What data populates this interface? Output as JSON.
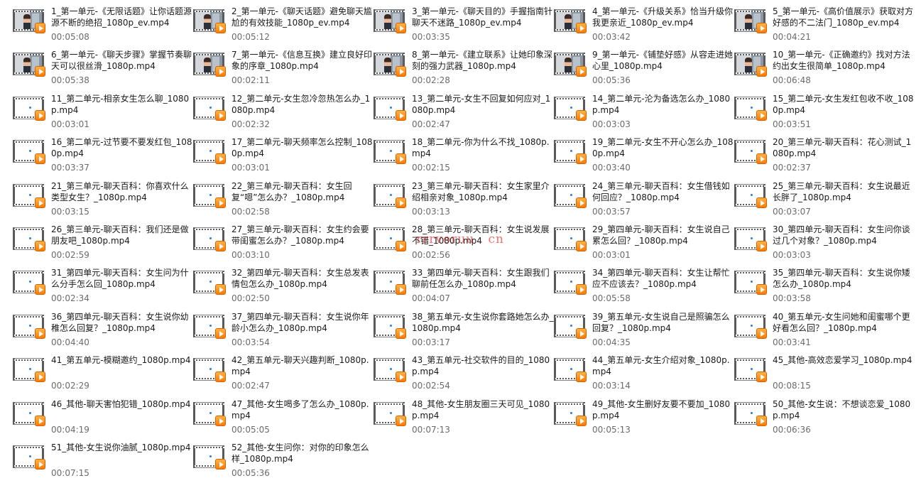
{
  "watermark": "rrrvoruu . cn",
  "files": [
    {
      "name": "1_第一单元-《无限话题》让你话题源源不断的绝招_1080p_ev.mp4",
      "duration": "00:05:08",
      "thumb": "photo"
    },
    {
      "name": "2_第一单元-《聊天话题》避免聊天尴尬的有效技能_1080p_ev.mp4",
      "duration": "00:05:12",
      "thumb": "photo"
    },
    {
      "name": "3_第一单元-《聊天目的》手握指南针聊天不迷路_1080p_ev.mp4",
      "duration": "00:03:35",
      "thumb": "photo"
    },
    {
      "name": "4_第一单元-《升级关系》恰当升级你我更亲近_1080p_ev.mp4",
      "duration": "00:03:42",
      "thumb": "photo"
    },
    {
      "name": "5_第一单元-《高价值展示》获取对方好感的不二法门_1080p_ev.mp4",
      "duration": "00:04:21",
      "thumb": "photo"
    },
    {
      "name": "6_第一单元-《聊天步骤》掌握节奏聊天可以很丝滑_1080p.mp4",
      "duration": "00:05:38",
      "thumb": "photo"
    },
    {
      "name": "7_第一单元-《信息互换》建立良好印象的序章_1080p.mp4",
      "duration": "00:02:11",
      "thumb": "photo"
    },
    {
      "name": "8_第一单元-《建立联系》让她印象深刻的强力武器_1080p.mp4",
      "duration": "00:02:28",
      "thumb": "photo"
    },
    {
      "name": "9_第一单元-《铺垫好感》从容走进她心里_1080p.mp4",
      "duration": "00:05:36",
      "thumb": "photo"
    },
    {
      "name": "10_第一单元-《正确邀约》找对方法约出女生很简单_1080p.mp4",
      "duration": "00:06:48",
      "thumb": "photo"
    },
    {
      "name": "11_第二单元-相亲女生怎么聊_1080p.mp4",
      "duration": "00:03:01",
      "thumb": "blank"
    },
    {
      "name": "12_第二单元-女生忽冷忽热怎么办_1080p.mp4",
      "duration": "00:02:32",
      "thumb": "blank"
    },
    {
      "name": "13_第二单元-女生不回复如何应对_1080p.mp4",
      "duration": "00:02:47",
      "thumb": "blank"
    },
    {
      "name": "14_第二单元-沦为备选怎么办_1080p.mp4",
      "duration": "00:03:03",
      "thumb": "blank"
    },
    {
      "name": "15_第二单元-女生发红包收不收_1080p.mp4",
      "duration": "00:03:51",
      "thumb": "blank"
    },
    {
      "name": "16_第二单元-过节要不要发红包_1080p.mp4",
      "duration": "00:03:37",
      "thumb": "blank"
    },
    {
      "name": "17_第二单元-聊天频率怎么控制_1080p.mp4",
      "duration": "00:03:01",
      "thumb": "blank"
    },
    {
      "name": "18_第二单元-你为什么不找_1080p.mp4",
      "duration": "00:02:15",
      "thumb": "blank"
    },
    {
      "name": "19_第二单元-女生不开心怎么办_1080p.mp4",
      "duration": "00:03:40",
      "thumb": "blank"
    },
    {
      "name": "20_第三单元-聊天百科：花心测试_1080p.mp4",
      "duration": "00:02:37",
      "thumb": "blank"
    },
    {
      "name": "21_第三单元-聊天百科：你喜欢什么类型女生？_1080p.mp4",
      "duration": "00:03:15",
      "thumb": "blank"
    },
    {
      "name": "22_第三单元-聊天百科：女生回复“嗯”怎么办？_1080p.mp4",
      "duration": "00:02:58",
      "thumb": "blank"
    },
    {
      "name": "23_第三单元-聊天百科：女生家里介绍相亲对象_1080p.mp4",
      "duration": "00:03:13",
      "thumb": "blank"
    },
    {
      "name": "24_第三单元-聊天百科：女生借钱如何回应？_1080p.mp4",
      "duration": "00:03:57",
      "thumb": "blank"
    },
    {
      "name": "25_第三单元-聊天百科：女生说最近长胖了_1080p.mp4",
      "duration": "00:03:07",
      "thumb": "blank"
    },
    {
      "name": "26_第三单元-聊天百科：我们还是做朋友吧_1080p.mp4",
      "duration": "00:02:59",
      "thumb": "blank"
    },
    {
      "name": "27_第三单元-聊天百科：女生约会要带闺蜜怎么办？_1080p.mp4",
      "duration": "00:03:10",
      "thumb": "blank"
    },
    {
      "name": "28_第三单元-聊天百科：女生说发展不错_1080p.mp4",
      "duration": "00:02:56",
      "thumb": "blank"
    },
    {
      "name": "29_第四单元-聊天百科：女生说自己累怎么回？_1080p.mp4",
      "duration": "00:03:01",
      "thumb": "blank"
    },
    {
      "name": "30_第四单元-聊天百科：女生问你谈过几个对象？_1080p.mp4",
      "duration": "00:03:03",
      "thumb": "blank"
    },
    {
      "name": "31_第四单元-聊天百科：女生问为什么分手怎么回_1080p.mp4",
      "duration": "00:02:34",
      "thumb": "blank"
    },
    {
      "name": "32_第四单元-聊天百科：女生总发表情包怎么办_1080p.mp4",
      "duration": "00:02:50",
      "thumb": "blank"
    },
    {
      "name": "33_第四单元-聊天百科：女生跟我们聊前任怎么办_1080p.mp4",
      "duration": "00:04:07",
      "thumb": "blank"
    },
    {
      "name": "34_第四单元-聊天百科：女生让帮忙应不应该去？_1080p.mp4",
      "duration": "00:05:58",
      "thumb": "blank"
    },
    {
      "name": "35_第四单元-聊天百科：女生说你矮怎么办_1080p.mp4",
      "duration": "00:03:58",
      "thumb": "blank"
    },
    {
      "name": "36_第四单元-聊天百科：女生说你幼稚怎么回复？_1080p.mp4",
      "duration": "00:04:40",
      "thumb": "blank"
    },
    {
      "name": "37_第四单元-聊天百科：女生说你年龄小怎么办_1080p.mp4",
      "duration": "00:03:54",
      "thumb": "blank"
    },
    {
      "name": "38_第五单元-女生说你套路她怎么办_1080p.mp4",
      "duration": "00:03:17",
      "thumb": "blank"
    },
    {
      "name": "39_第五单元-女生说自己是照骗怎么回复？_1080p.mp4",
      "duration": "00:04:35",
      "thumb": "blank"
    },
    {
      "name": "40_第五单元-女生问她和闺蜜哪个更好看怎么回？_1080p.mp4",
      "duration": "00:03:41",
      "thumb": "blank"
    },
    {
      "name": "41_第五单元-模糊邀约_1080p.mp4",
      "duration": "00:02:29",
      "thumb": "blank"
    },
    {
      "name": "42_第五单元-聊天兴趣判断_1080p.mp4",
      "duration": "00:02:47",
      "thumb": "blank"
    },
    {
      "name": "43_第五单元-社交软件的目的_1080p.mp4",
      "duration": "00:02:54",
      "thumb": "blank"
    },
    {
      "name": "44_第五单元-女生介绍对象_1080p.mp4",
      "duration": "00:03:14",
      "thumb": "blank"
    },
    {
      "name": "45_其他-高效恋爱学习_1080p.mp4",
      "duration": "00:08:15",
      "thumb": "blank"
    },
    {
      "name": "46_其他-聊天害怕犯错_1080p.mp4",
      "duration": "00:04:19",
      "thumb": "blank"
    },
    {
      "name": "47_其他-女生喝多了怎么办_1080p.mp4",
      "duration": "00:05:05",
      "thumb": "blank"
    },
    {
      "name": "48_其他-女生朋友圈三天可见_1080p.mp4",
      "duration": "00:07:13",
      "thumb": "blank"
    },
    {
      "name": "49_其他-女生删好友要不要加_1080p.mp4",
      "duration": "00:05:13",
      "thumb": "blank"
    },
    {
      "name": "50_其他-女生说：不想谈恋爱_1080p.mp4",
      "duration": "00:06:36",
      "thumb": "blank"
    },
    {
      "name": "51_其他-女生说你油腻_1080p.mp4",
      "duration": "00:07:15",
      "thumb": "blank"
    },
    {
      "name": "52_其他-女生问你：对你的印象怎么样_1080p.mp4",
      "duration": "00:05:36",
      "thumb": "blank"
    }
  ]
}
